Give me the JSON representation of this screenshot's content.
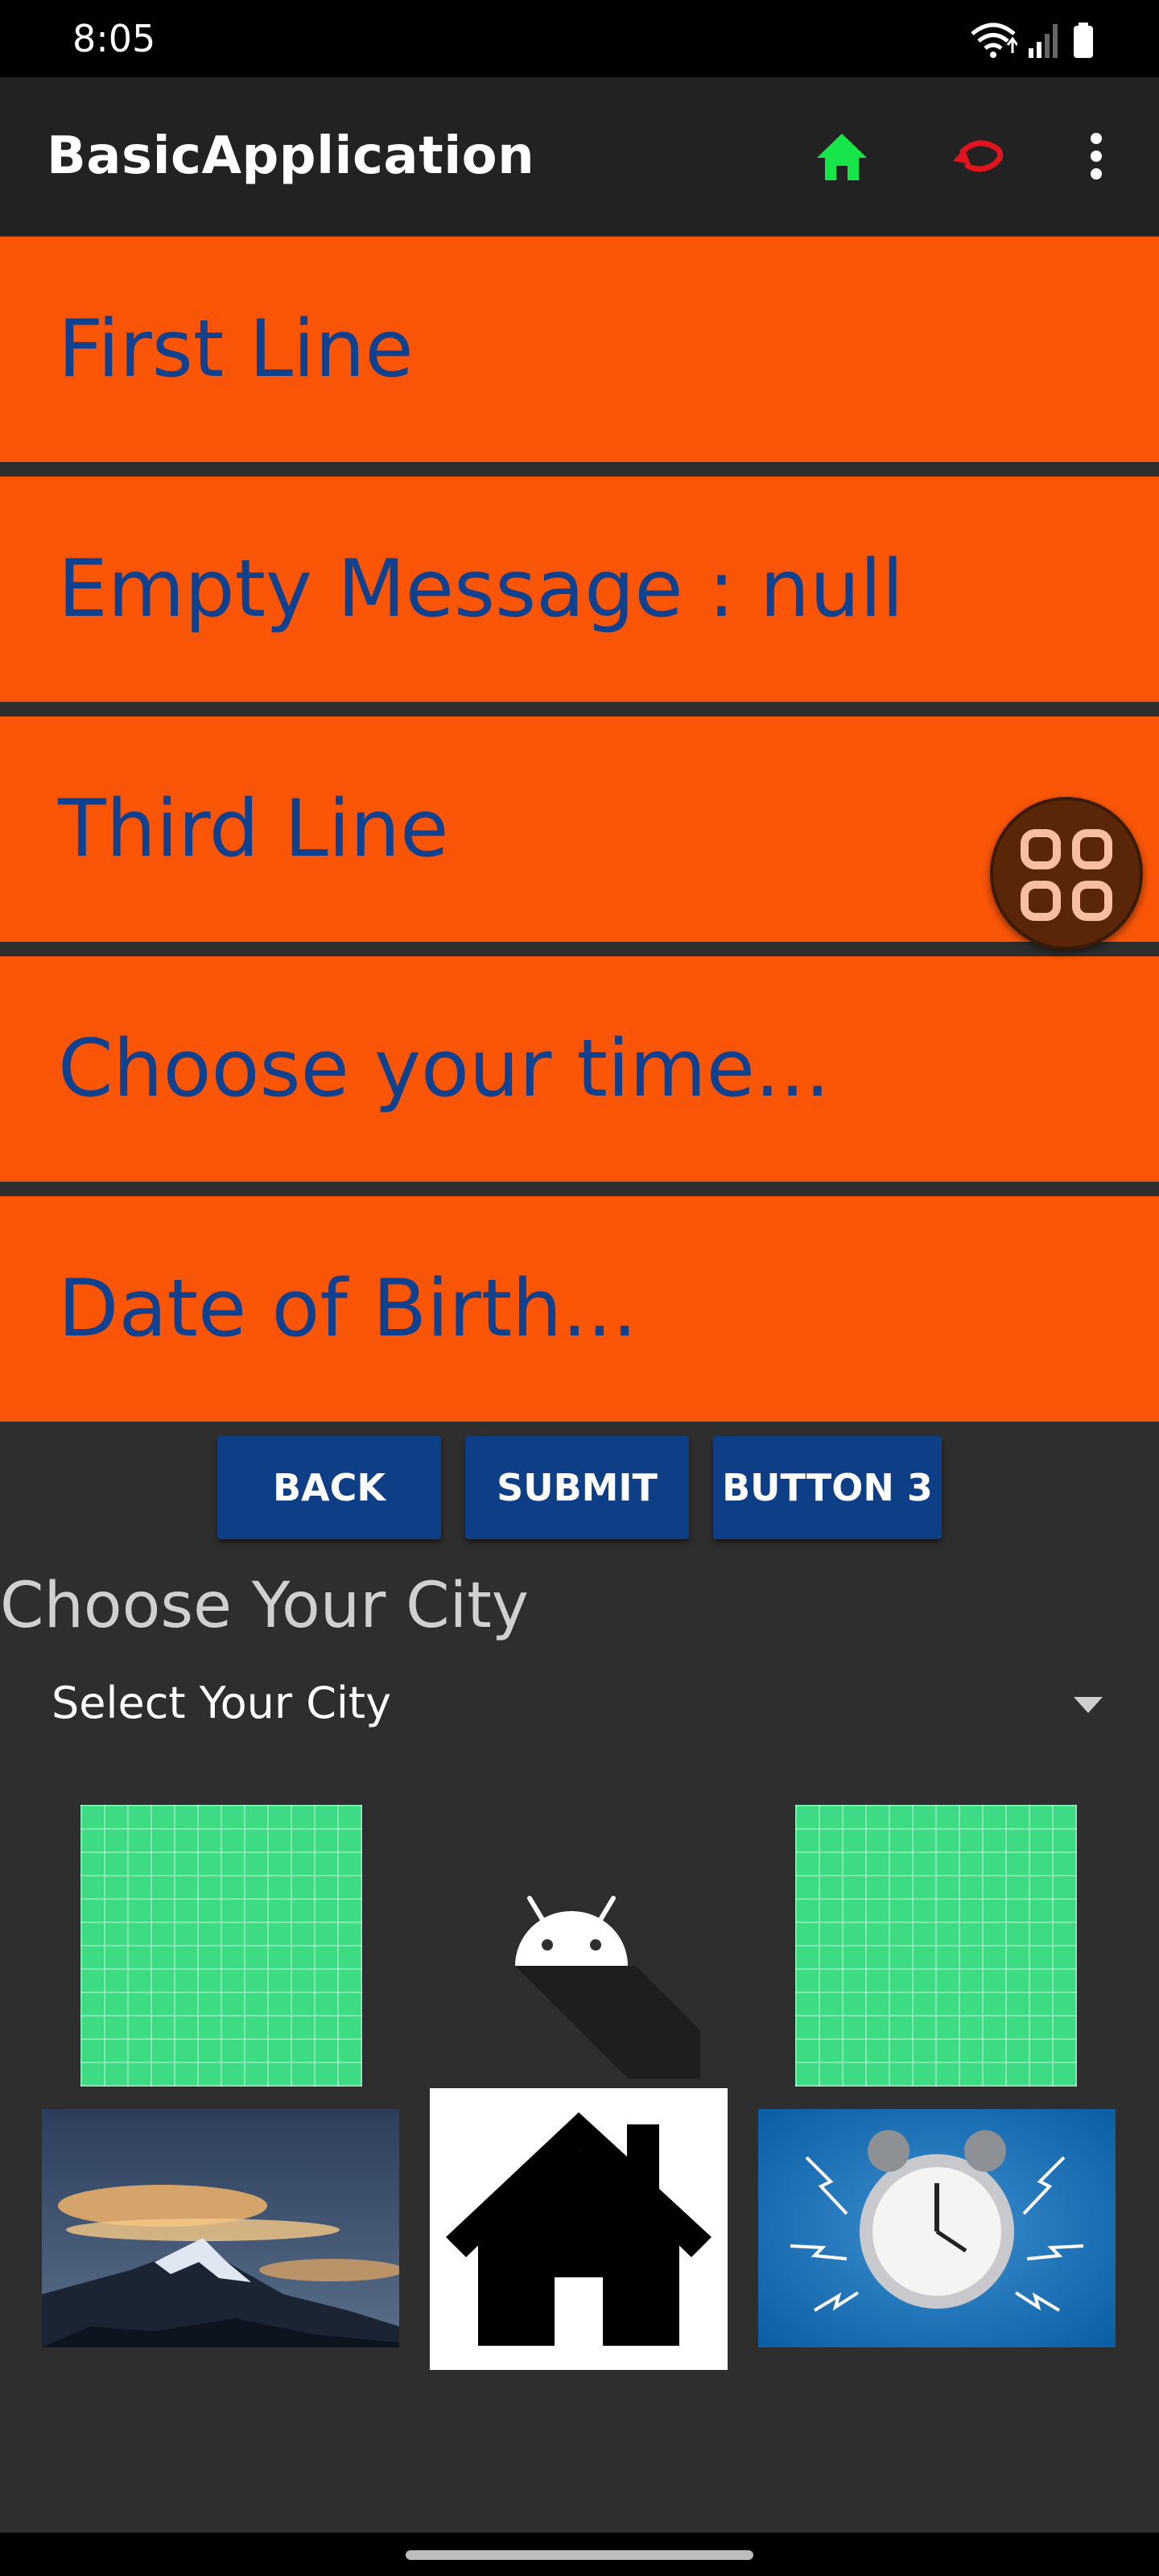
{
  "status_bar": {
    "time": "8:05"
  },
  "app_bar": {
    "title": "BasicApplication",
    "home_color": "#16e64a",
    "undo_color": "#e0141e"
  },
  "rows": [
    {
      "label": "First Line"
    },
    {
      "label": "Empty Message : null"
    },
    {
      "label": "Third Line"
    },
    {
      "label": "Choose your time..."
    },
    {
      "label": "Date of Birth..."
    }
  ],
  "buttons": {
    "back": "BACK",
    "submit": "SUBMIT",
    "button3": "BUTTON 3"
  },
  "city": {
    "label": "Choose Your City",
    "spinner_value": "Select Your City"
  },
  "colors": {
    "row_bg": "#fb5607",
    "row_text": "#10418f",
    "button_bg": "#0d3e86",
    "android_green": "#3ddc84"
  },
  "images": [
    "grid-image",
    "android-logo",
    "grid-image",
    "mountain-photo",
    "house-icon",
    "alarm-clock-photo"
  ]
}
